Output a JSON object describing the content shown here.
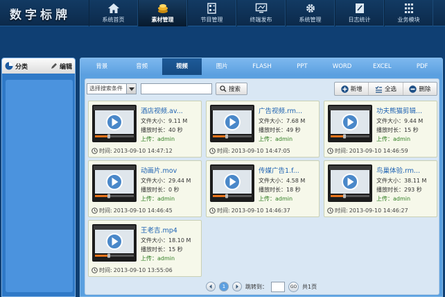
{
  "app": {
    "logo": "数字标牌"
  },
  "nav": [
    {
      "label": "系统首页",
      "icon": "home-icon"
    },
    {
      "label": "素材管理",
      "icon": "materials-icon",
      "active": true
    },
    {
      "label": "节目管理",
      "icon": "program-icon"
    },
    {
      "label": "终端发布",
      "icon": "monitor-icon"
    },
    {
      "label": "系统管理",
      "icon": "gear-icon"
    },
    {
      "label": "日志统计",
      "icon": "log-icon"
    },
    {
      "label": "业务模块",
      "icon": "grid-icon"
    }
  ],
  "sidebar": {
    "category_label": "分类",
    "edit_label": "编辑"
  },
  "tabs": [
    {
      "label": "背景"
    },
    {
      "label": "音频"
    },
    {
      "label": "视频",
      "active": true
    },
    {
      "label": "图片"
    },
    {
      "label": "FLASH"
    },
    {
      "label": "PPT"
    },
    {
      "label": "WORD"
    },
    {
      "label": "EXCEL"
    },
    {
      "label": "PDF"
    }
  ],
  "toolbar": {
    "select_value": "选择搜索条件",
    "search_value": "",
    "search_label": "搜索",
    "add_label": "新增",
    "select_all_label": "全选",
    "delete_label": "删除"
  },
  "cards": [
    {
      "title": "酒店视频.av...",
      "size_label": "文件大小：",
      "size": "9.11 M",
      "duration_label": "播放时长：",
      "duration": "40 秒",
      "uploader_label": "上传：",
      "uploader": "admin",
      "time_label": "时间:",
      "time": "2013-09-10 14:47:12"
    },
    {
      "title": "广告视频.rm...",
      "size_label": "文件大小：",
      "size": "7.68 M",
      "duration_label": "播放时长：",
      "duration": "49 秒",
      "uploader_label": "上传：",
      "uploader": "admin",
      "time_label": "时间:",
      "time": "2013-09-10 14:47:05"
    },
    {
      "title": "功夫熊猫剪辑...",
      "size_label": "文件大小：",
      "size": "9.44 M",
      "duration_label": "播放时长：",
      "duration": "15 秒",
      "uploader_label": "上传：",
      "uploader": "admin",
      "time_label": "时间:",
      "time": "2013-09-10 14:46:59"
    },
    {
      "title": "动画片.mov",
      "size_label": "文件大小：",
      "size": "29.44 M",
      "duration_label": "播放时长：",
      "duration": "0 秒",
      "uploader_label": "上传：",
      "uploader": "admin",
      "time_label": "时间:",
      "time": "2013-09-10 14:46:45"
    },
    {
      "title": "传媒广告1.f...",
      "size_label": "文件大小：",
      "size": "4.58 M",
      "duration_label": "播放时长：",
      "duration": "18 秒",
      "uploader_label": "上传：",
      "uploader": "admin",
      "time_label": "时间:",
      "time": "2013-09-10 14:46:37"
    },
    {
      "title": "鸟巢体验.rm...",
      "size_label": "文件大小：",
      "size": "38.11 M",
      "duration_label": "播放时长：",
      "duration": "293 秒",
      "uploader_label": "上传：",
      "uploader": "admin",
      "time_label": "时间:",
      "time": "2013-09-10 14:46:27"
    },
    {
      "title": "王老吉.mp4",
      "size_label": "文件大小：",
      "size": "18.10 M",
      "duration_label": "播放时长：",
      "duration": "15 秒",
      "uploader_label": "上传：",
      "uploader": "admin",
      "time_label": "时间:",
      "time": "2013-09-10 13:55:06"
    }
  ],
  "pager": {
    "current_page": "1",
    "jump_label": "跳转到：",
    "jump_value": "",
    "go_label": "GO",
    "total_label": "共1页"
  },
  "colors": {
    "accent": "#1e62b3",
    "topbar": "#0c2a4b",
    "panel": "#5aa0e0",
    "card_bg": "#f6f8ea",
    "uploader": "#2f7d21"
  }
}
